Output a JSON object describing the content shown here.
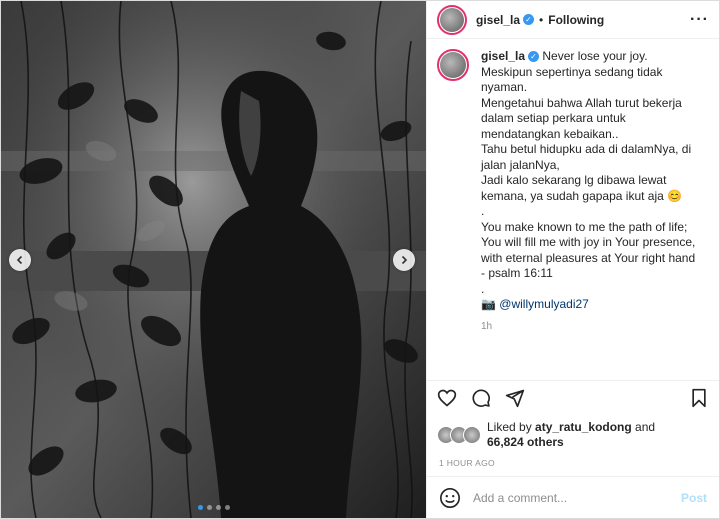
{
  "header": {
    "username": "gisel_la",
    "separator": "•",
    "following_label": "Following",
    "more_label": "···"
  },
  "caption": {
    "username": "gisel_la",
    "lines": [
      "Never lose your joy.",
      "Meskipun sepertinya sedang tidak",
      "nyaman.",
      "Mengetahui bahwa Allah turut bekerja",
      "dalam setiap perkara untuk",
      "mendatangkan kebaikan..",
      "Tahu betul hidupku ada di dalamNya, di",
      "jalan jalanNya,",
      "Jadi kalo sekarang lg dibawa lewat",
      "kemana, ya sudah gapapa ikut aja 😊",
      ".",
      "You make known to me the path of life;",
      "You will fill me with joy in Your presence,",
      "with eternal pleasures at Your right hand",
      "- psalm 16:11",
      "."
    ],
    "camera_emoji": "📷",
    "mention": "@willymulyadi27",
    "time_small": "1h"
  },
  "likes": {
    "prefix": "Liked by ",
    "user": "aty_ratu_kodong",
    "and": " and",
    "count": "66,824 others"
  },
  "time_ago": "1 HOUR AGO",
  "comment_box": {
    "placeholder": "Add a comment...",
    "post_label": "Post",
    "emoji_icon": "smiley-icon"
  },
  "carousel": {
    "total": 4,
    "active_index": 0
  },
  "colors": {
    "verified": "#3897f0",
    "post_disabled": "#b2dffc",
    "link": "#00376b"
  }
}
